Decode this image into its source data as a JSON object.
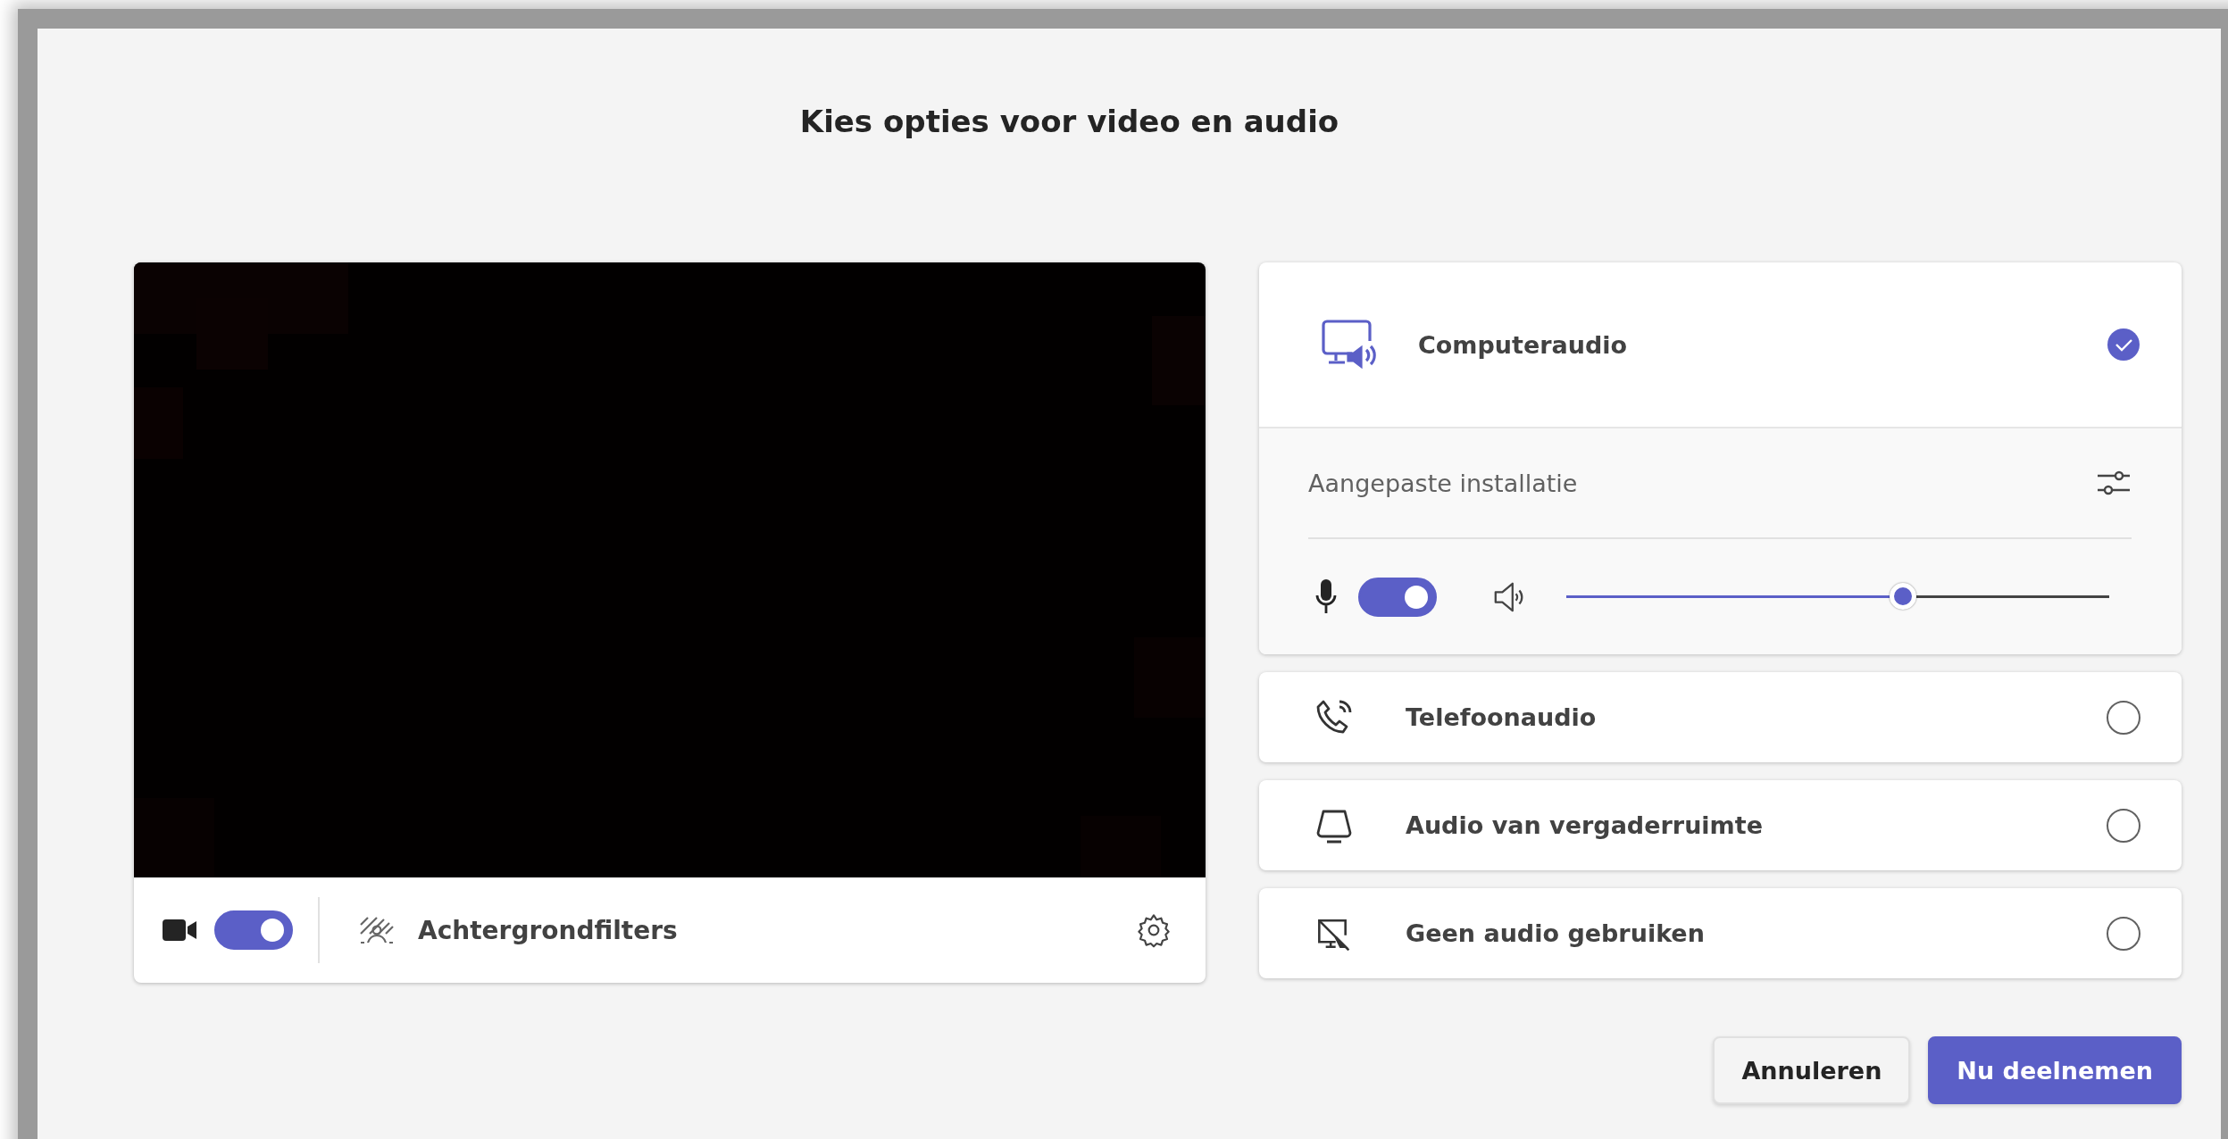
{
  "dialog": {
    "title": "Kies opties voor video en audio"
  },
  "video": {
    "kind": "picture",
    "camera_on": true,
    "filters_label": "Achtergrondfilters"
  },
  "audio_options": [
    {
      "kind": "computer",
      "label": "Computeraudio",
      "selected": true,
      "setup": {
        "label": "Aangepaste installatie",
        "mic_on": true,
        "volume": {
          "level": 0.62
        }
      }
    },
    {
      "kind": "phone",
      "label": "Telefoonaudio",
      "selected": false
    },
    {
      "kind": "room",
      "label": "Audio van vergaderruimte",
      "selected": false
    },
    {
      "kind": "none",
      "label": "Geen audio gebruiken",
      "selected": false
    }
  ],
  "buttons": [
    {
      "label": "Annuleren",
      "primary": false
    },
    {
      "label": "Nu deelnemen",
      "primary": true
    }
  ]
}
